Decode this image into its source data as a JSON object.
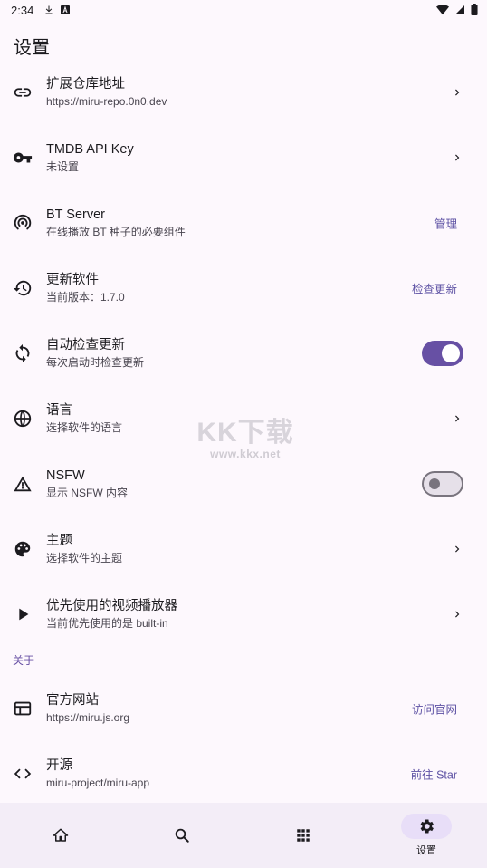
{
  "status_bar": {
    "time": "2:34",
    "left_icons": [
      "download-icon",
      "a-box-icon"
    ],
    "right_icons": [
      "wifi-icon",
      "cell-signal-icon",
      "battery-icon"
    ]
  },
  "page": {
    "title": "设置"
  },
  "settings": [
    {
      "id": "repo",
      "icon": "link-icon",
      "title": "扩展仓库地址",
      "subtitle": "https://miru-repo.0n0.dev",
      "trailing": "chevron"
    },
    {
      "id": "tmdb",
      "icon": "key-icon",
      "title": "TMDB API Key",
      "subtitle": "未设置",
      "trailing": "chevron"
    },
    {
      "id": "bt",
      "icon": "broadcast-icon",
      "title": "BT Server",
      "subtitle": "在线播放 BT 种子的必要组件",
      "trailing": "button",
      "action": "管理"
    },
    {
      "id": "update",
      "icon": "history-icon",
      "title": "更新软件",
      "subtitle": "当前版本：1.7.0",
      "trailing": "button",
      "action": "检查更新"
    },
    {
      "id": "autocheck",
      "icon": "sync-icon",
      "title": "自动检查更新",
      "subtitle": "每次启动时检查更新",
      "trailing": "switch",
      "enabled": true
    },
    {
      "id": "language",
      "icon": "globe-icon",
      "title": "语言",
      "subtitle": "选择软件的语言",
      "trailing": "chevron"
    },
    {
      "id": "nsfw",
      "icon": "warning-icon",
      "title": "NSFW",
      "subtitle": "显示 NSFW 内容",
      "trailing": "switch",
      "enabled": false
    },
    {
      "id": "theme",
      "icon": "palette-icon",
      "title": "主题",
      "subtitle": "选择软件的主题",
      "trailing": "chevron"
    },
    {
      "id": "player",
      "icon": "play-icon",
      "title": "优先使用的视频播放器",
      "subtitle": "当前优先使用的是 built-in",
      "trailing": "chevron"
    }
  ],
  "about": {
    "header": "关于",
    "items": [
      {
        "id": "website",
        "icon": "web-icon",
        "title": "官方网站",
        "subtitle": "https://miru.js.org",
        "action": "访问官网"
      },
      {
        "id": "source",
        "icon": "code-icon",
        "title": "开源",
        "subtitle": "miru-project/miru-app",
        "action": "前往 Star"
      }
    ]
  },
  "watermark": {
    "main": "KK下载",
    "sub": "www.kkx.net"
  },
  "bottom_nav": [
    {
      "id": "home",
      "icon": "home-icon",
      "label": "",
      "active": false
    },
    {
      "id": "search",
      "icon": "search-icon",
      "label": "",
      "active": false
    },
    {
      "id": "extensions",
      "icon": "grid-icon",
      "label": "",
      "active": false
    },
    {
      "id": "settings",
      "icon": "gear-icon",
      "label": "设置",
      "active": true
    }
  ],
  "colors": {
    "accent": "#6750a4",
    "action_text": "#5c50a3",
    "background": "#fdf8fd",
    "nav_bg": "#f3edf7"
  }
}
